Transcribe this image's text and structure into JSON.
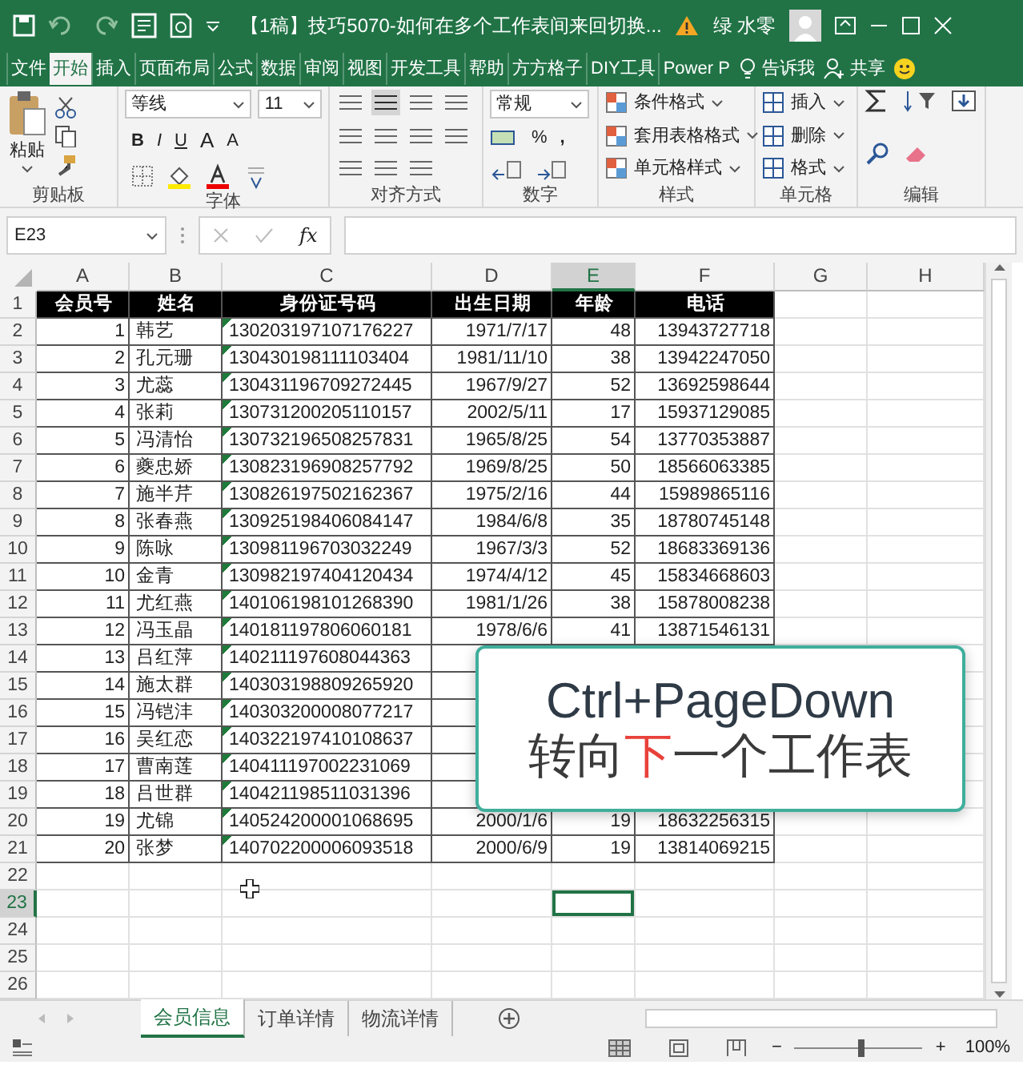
{
  "title_bar": {
    "title": "【1稿】技巧5070-如何在多个工作表间来回切换...",
    "user": "绿 水零"
  },
  "ribbon_tabs": [
    {
      "label": "文件",
      "selected": false
    },
    {
      "label": "开始",
      "selected": true
    },
    {
      "label": "插入",
      "selected": false
    },
    {
      "label": "页面布局",
      "selected": false
    },
    {
      "label": "公式",
      "selected": false
    },
    {
      "label": "数据",
      "selected": false
    },
    {
      "label": "审阅",
      "selected": false
    },
    {
      "label": "视图",
      "selected": false
    },
    {
      "label": "开发工具",
      "selected": false
    },
    {
      "label": "帮助",
      "selected": false
    },
    {
      "label": "方方格子",
      "selected": false
    },
    {
      "label": "DIY工具",
      "selected": false
    },
    {
      "label": "Power P",
      "selected": false
    }
  ],
  "tell_me": "告诉我",
  "share": "共享",
  "ribbon": {
    "paste": "粘贴",
    "font_name": "等线",
    "font_size": "11",
    "bold": "B",
    "italic": "I",
    "underline": "U",
    "grow_font": "A",
    "shrink_font": "A",
    "number_format": "常规",
    "percent": "%",
    "comma": ",",
    "style_buttons": [
      "条件格式",
      "套用表格格式",
      "单元格样式"
    ],
    "cell_buttons": [
      "插入",
      "删除",
      "格式"
    ],
    "groups": [
      "剪贴板",
      "字体",
      "对齐方式",
      "数字",
      "样式",
      "单元格",
      "编辑"
    ]
  },
  "name_box": "E23",
  "fx": "fx",
  "columns": [
    {
      "label": "A",
      "selected": false
    },
    {
      "label": "B",
      "selected": false
    },
    {
      "label": "C",
      "selected": false
    },
    {
      "label": "D",
      "selected": false
    },
    {
      "label": "E",
      "selected": true
    },
    {
      "label": "F",
      "selected": false
    },
    {
      "label": "G",
      "selected": false
    },
    {
      "label": "H",
      "selected": false
    }
  ],
  "row_headers": [
    {
      "label": "1",
      "selected": false
    },
    {
      "label": "2",
      "selected": false
    },
    {
      "label": "3",
      "selected": false
    },
    {
      "label": "4",
      "selected": false
    },
    {
      "label": "5",
      "selected": false
    },
    {
      "label": "6",
      "selected": false
    },
    {
      "label": "7",
      "selected": false
    },
    {
      "label": "8",
      "selected": false
    },
    {
      "label": "9",
      "selected": false
    },
    {
      "label": "10",
      "selected": false
    },
    {
      "label": "11",
      "selected": false
    },
    {
      "label": "12",
      "selected": false
    },
    {
      "label": "13",
      "selected": false
    },
    {
      "label": "14",
      "selected": false
    },
    {
      "label": "15",
      "selected": false
    },
    {
      "label": "16",
      "selected": false
    },
    {
      "label": "17",
      "selected": false
    },
    {
      "label": "18",
      "selected": false
    },
    {
      "label": "19",
      "selected": false
    },
    {
      "label": "20",
      "selected": false
    },
    {
      "label": "21",
      "selected": false
    },
    {
      "label": "22",
      "selected": false
    },
    {
      "label": "23",
      "selected": true
    },
    {
      "label": "24",
      "selected": false
    },
    {
      "label": "25",
      "selected": false
    },
    {
      "label": "26",
      "selected": false
    }
  ],
  "table_header": [
    "会员号",
    "姓名",
    "身份证号码",
    "出生日期",
    "年龄",
    "电话"
  ],
  "rows": [
    {
      "cells": [
        "1",
        "韩艺",
        "130203197107176227",
        "1971/7/17",
        "48",
        "13943727718"
      ],
      "flagged": true
    },
    {
      "cells": [
        "2",
        "孔元珊",
        "130430198111103404",
        "1981/11/10",
        "38",
        "13942247050"
      ],
      "flagged": true
    },
    {
      "cells": [
        "3",
        "尤蕊",
        "130431196709272445",
        "1967/9/27",
        "52",
        "13692598644"
      ],
      "flagged": true
    },
    {
      "cells": [
        "4",
        "张莉",
        "130731200205110157",
        "2002/5/11",
        "17",
        "15937129085"
      ],
      "flagged": true
    },
    {
      "cells": [
        "5",
        "冯清怡",
        "130732196508257831",
        "1965/8/25",
        "54",
        "13770353887"
      ],
      "flagged": true
    },
    {
      "cells": [
        "6",
        "夔忠娇",
        "130823196908257792",
        "1969/8/25",
        "50",
        "18566063385"
      ],
      "flagged": true
    },
    {
      "cells": [
        "7",
        "施半芹",
        "130826197502162367",
        "1975/2/16",
        "44",
        "15989865116"
      ],
      "flagged": true
    },
    {
      "cells": [
        "8",
        "张春燕",
        "130925198406084147",
        "1984/6/8",
        "35",
        "18780745148"
      ],
      "flagged": true
    },
    {
      "cells": [
        "9",
        "陈咏",
        "130981196703032249",
        "1967/3/3",
        "52",
        "18683369136"
      ],
      "flagged": true
    },
    {
      "cells": [
        "10",
        "金青",
        "130982197404120434",
        "1974/4/12",
        "45",
        "15834668603"
      ],
      "flagged": true
    },
    {
      "cells": [
        "11",
        "尤红燕",
        "140106198101268390",
        "1981/1/26",
        "38",
        "15878008238"
      ],
      "flagged": true
    },
    {
      "cells": [
        "12",
        "冯玉晶",
        "140181197806060181",
        "1978/6/6",
        "41",
        "13871546131"
      ],
      "flagged": true
    },
    {
      "cells": [
        "13",
        "吕红萍",
        "140211197608044363"
      ],
      "flagged": true
    },
    {
      "cells": [
        "14",
        "施太群",
        "140303198809265920"
      ],
      "flagged": true
    },
    {
      "cells": [
        "15",
        "冯铠沣",
        "140303200008077217"
      ],
      "flagged": true
    },
    {
      "cells": [
        "16",
        "吴红恋",
        "140322197410108637"
      ],
      "flagged": true
    },
    {
      "cells": [
        "17",
        "曹南莲",
        "140411197002231069"
      ],
      "flagged": true
    },
    {
      "cells": [
        "18",
        "吕世群",
        "140421198511031396"
      ],
      "flagged": true
    },
    {
      "cells": [
        "19",
        "尤锦",
        "140524200001068695",
        "2000/1/6",
        "19",
        "18632256315"
      ],
      "flagged": true
    },
    {
      "cells": [
        "20",
        "张梦",
        "140702200006093518",
        "2000/6/9",
        "19",
        "13814069215"
      ],
      "flagged": true
    }
  ],
  "overlay": {
    "shortcut": "Ctrl+PageDown",
    "caption": [
      {
        "text": "转向",
        "highlight": false
      },
      {
        "text": "下",
        "highlight": true
      },
      {
        "text": "一个工作表",
        "highlight": false
      }
    ]
  },
  "sheet_tabs": [
    {
      "label": "会员信息",
      "selected": true
    },
    {
      "label": "订单详情",
      "selected": false
    },
    {
      "label": "物流详情",
      "selected": false
    }
  ],
  "status_bar": {
    "zoom_out": "−",
    "zoom_in": "+",
    "zoom": "100%",
    "zoom_slider": {
      "level": 0.5
    }
  }
}
